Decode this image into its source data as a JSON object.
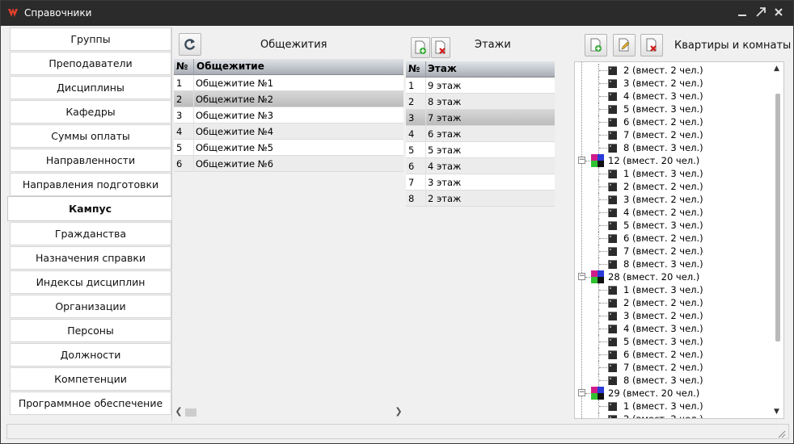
{
  "window": {
    "title": "Справочники",
    "controls": [
      "minimize-icon",
      "maximize-icon",
      "close-icon"
    ]
  },
  "sidebar": {
    "items": [
      {
        "label": "Группы"
      },
      {
        "label": "Преподаватели"
      },
      {
        "label": "Дисциплины"
      },
      {
        "label": "Кафедры"
      },
      {
        "label": "Суммы оплаты"
      },
      {
        "label": "Направленности"
      },
      {
        "label": "Направления подготовки"
      },
      {
        "label": "Кампус",
        "active": true
      },
      {
        "label": "Гражданства"
      },
      {
        "label": "Назначения справки"
      },
      {
        "label": "Индексы дисциплин"
      },
      {
        "label": "Организации"
      },
      {
        "label": "Персоны"
      },
      {
        "label": "Должности"
      },
      {
        "label": "Компетенции"
      },
      {
        "label": "Программное обеспечение"
      }
    ]
  },
  "dorms": {
    "title": "Общежития",
    "refresh_icon": "refresh-icon",
    "columns": [
      "№",
      "Общежитие"
    ],
    "rows": [
      {
        "n": "1",
        "name": "Общежитие №1"
      },
      {
        "n": "2",
        "name": "Общежитие №2",
        "selected": true
      },
      {
        "n": "3",
        "name": "Общежитие №3"
      },
      {
        "n": "4",
        "name": "Общежитие №4"
      },
      {
        "n": "5",
        "name": "Общежитие №5"
      },
      {
        "n": "6",
        "name": "Общежитие №6"
      }
    ]
  },
  "floors": {
    "title": "Этажи",
    "add_icon": "add-document-icon",
    "delete_icon": "delete-document-icon",
    "columns": [
      "№",
      "Этаж"
    ],
    "rows": [
      {
        "n": "1",
        "name": "9 этаж"
      },
      {
        "n": "2",
        "name": "8 этаж"
      },
      {
        "n": "3",
        "name": "7 этаж",
        "selected": true
      },
      {
        "n": "4",
        "name": "6 этаж"
      },
      {
        "n": "5",
        "name": "5 этаж"
      },
      {
        "n": "6",
        "name": "4 этаж"
      },
      {
        "n": "7",
        "name": "3 этаж"
      },
      {
        "n": "8",
        "name": "2 этаж"
      }
    ]
  },
  "rooms": {
    "title": "Квартиры и комнаты",
    "add_icon": "add-document-icon",
    "edit_icon": "edit-document-icon",
    "delete_icon": "delete-document-icon",
    "tree": [
      {
        "type": "room",
        "label": "2 (вмест. 2 чел.)"
      },
      {
        "type": "room",
        "label": "3 (вмест. 2 чел.)"
      },
      {
        "type": "room",
        "label": "4 (вмест. 3 чел.)"
      },
      {
        "type": "room",
        "label": "5 (вмест. 3 чел.)"
      },
      {
        "type": "room",
        "label": "6 (вмест. 2 чел.)"
      },
      {
        "type": "room",
        "label": "7 (вмест. 2 чел.)"
      },
      {
        "type": "room",
        "label": "8 (вмест. 3 чел.)"
      },
      {
        "type": "apt",
        "label": "12 (вмест. 20 чел.)"
      },
      {
        "type": "room",
        "label": "1 (вмест. 3 чел.)"
      },
      {
        "type": "room",
        "label": "2 (вмест. 2 чел.)"
      },
      {
        "type": "room",
        "label": "3 (вмест. 2 чел.)"
      },
      {
        "type": "room",
        "label": "4 (вмест. 2 чел.)"
      },
      {
        "type": "room",
        "label": "5 (вмест. 3 чел.)"
      },
      {
        "type": "room",
        "label": "6 (вмест. 2 чел.)"
      },
      {
        "type": "room",
        "label": "7 (вмест. 2 чел.)"
      },
      {
        "type": "room",
        "label": "8 (вмест. 3 чел.)"
      },
      {
        "type": "apt",
        "label": "28 (вмест. 20 чел.)"
      },
      {
        "type": "room",
        "label": "1 (вмест. 3 чел.)"
      },
      {
        "type": "room",
        "label": "2 (вмест. 2 чел.)"
      },
      {
        "type": "room",
        "label": "3 (вмест. 2 чел.)"
      },
      {
        "type": "room",
        "label": "4 (вмест. 3 чел.)"
      },
      {
        "type": "room",
        "label": "5 (вмест. 3 чел.)"
      },
      {
        "type": "room",
        "label": "6 (вмест. 2 чел.)"
      },
      {
        "type": "room",
        "label": "7 (вмест. 2 чел.)"
      },
      {
        "type": "room",
        "label": "8 (вмест. 3 чел.)"
      },
      {
        "type": "apt",
        "label": "29 (вмест. 20 чел.)"
      },
      {
        "type": "room",
        "label": "1 (вмест. 3 чел.)"
      },
      {
        "type": "room",
        "label": "2 (вмест. 2 чел.)"
      }
    ]
  },
  "colors": {
    "titlebar": "#2b2b2b",
    "selection": "#c4c4c4",
    "header_gradient_top": "#e0e3e8",
    "header_gradient_bottom": "#a8acb4"
  }
}
